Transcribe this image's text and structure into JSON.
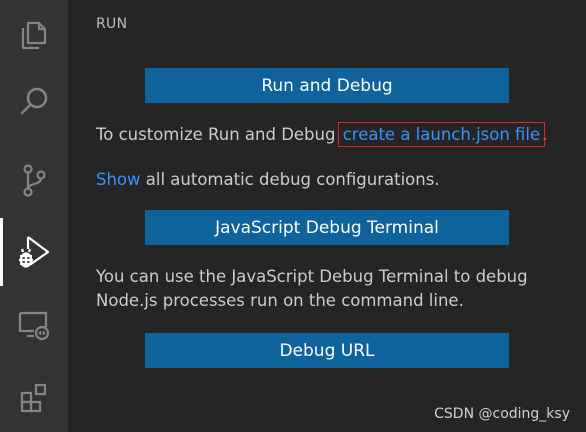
{
  "activity_bar": {
    "items": [
      {
        "icon": "files-icon"
      },
      {
        "icon": "search-icon"
      },
      {
        "icon": "source-control-icon"
      },
      {
        "icon": "run-debug-icon",
        "active": true
      },
      {
        "icon": "remote-explorer-icon"
      },
      {
        "icon": "extensions-icon"
      }
    ]
  },
  "sidebar": {
    "title": "RUN",
    "run_debug_button": "Run and Debug",
    "customize_text": "To customize Run and Debug ",
    "launch_link": "create a launch.json file",
    "customize_period": ".",
    "show_link": "Show",
    "show_rest": " all automatic debug configurations.",
    "js_terminal_button": "JavaScript Debug Terminal",
    "js_terminal_line1": "You can use the JavaScript Debug Terminal to debug",
    "js_terminal_line2": "Node.js processes run on the command line.",
    "debug_url_button": "Debug URL"
  },
  "watermark": "CSDN @coding_ksy",
  "colors": {
    "activity_bar": "#333333",
    "sidebar": "#252526",
    "button": "#0e639c",
    "link": "#3794ff",
    "highlight_box": "#e0252b"
  }
}
